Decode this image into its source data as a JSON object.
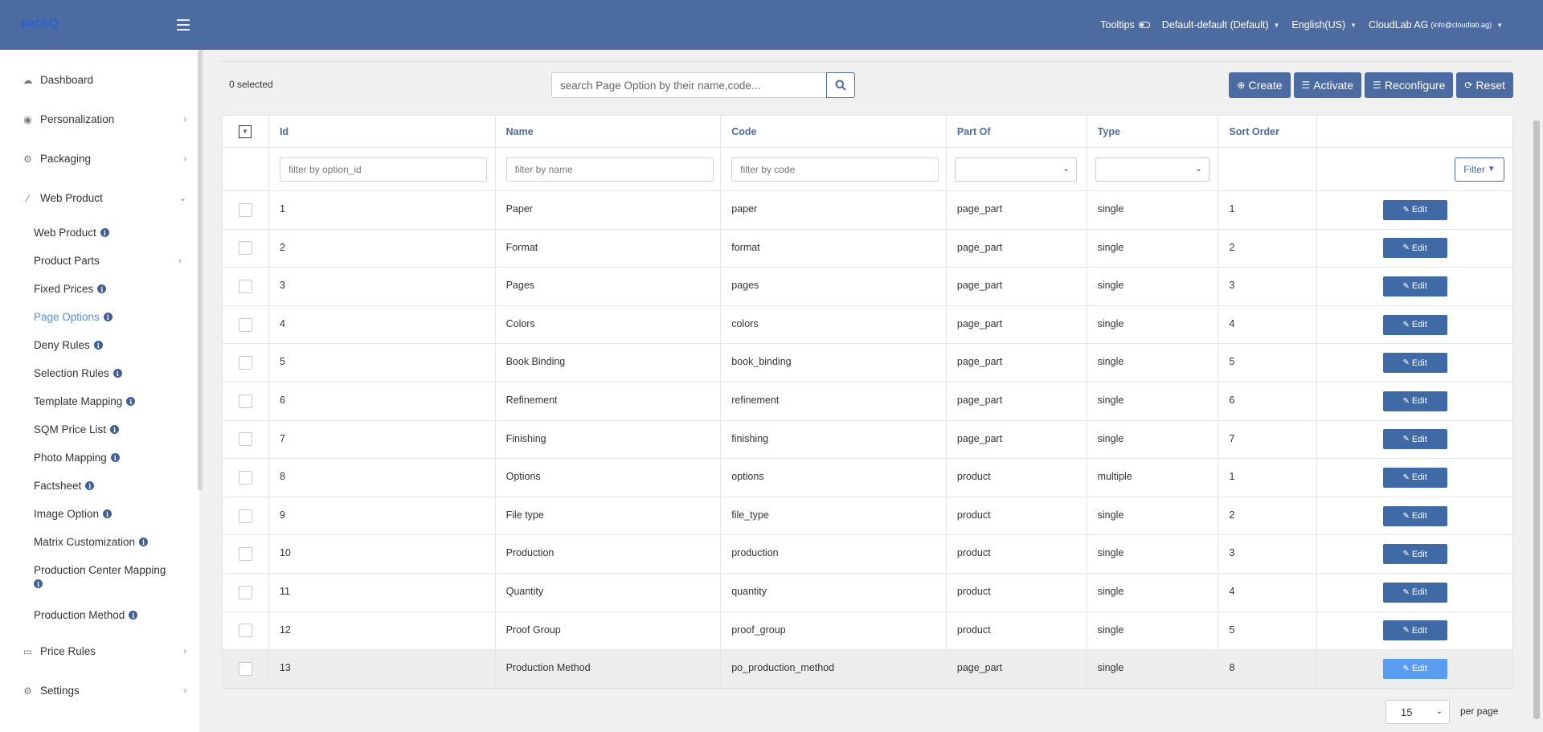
{
  "app": {
    "logo": "packQ"
  },
  "topnav": {
    "tooltips": "Tooltips",
    "branding": "Default-default (Default)",
    "language": "English(US)",
    "company": "CloudLab AG",
    "email": "(info@cloudlab.ag)"
  },
  "sidebar": {
    "dashboard": "Dashboard",
    "personalization": "Personalization",
    "packaging": "Packaging",
    "web_product": "Web Product",
    "sub": [
      "Web Product",
      "Product Parts",
      "Fixed Prices",
      "Page Options",
      "Deny Rules",
      "Selection Rules",
      "Template Mapping",
      "SQM Price List",
      "Photo Mapping",
      "Factsheet",
      "Image Option",
      "Matrix Customization",
      "Production Center Mapping",
      "Production Method"
    ],
    "price_rules": "Price Rules",
    "settings": "Settings"
  },
  "toolbar": {
    "selected": "0 selected",
    "search_placeholder": "search Page Option by their name,code...",
    "create": "Create",
    "activate": "Activate",
    "reconfigure": "Reconfigure",
    "reset": "Reset"
  },
  "table": {
    "headers": [
      "Id",
      "Name",
      "Code",
      "Part Of",
      "Type",
      "Sort Order"
    ],
    "filters": {
      "id_placeholder": "filter by option_id",
      "name_placeholder": "filter by name",
      "code_placeholder": "filter by code",
      "filter_button": "Filter"
    },
    "edit_label": "Edit",
    "rows": [
      {
        "id": "1",
        "name": "Paper",
        "code": "paper",
        "part_of": "page_part",
        "type": "single",
        "sort": "1"
      },
      {
        "id": "2",
        "name": "Format",
        "code": "format",
        "part_of": "page_part",
        "type": "single",
        "sort": "2"
      },
      {
        "id": "3",
        "name": "Pages",
        "code": "pages",
        "part_of": "page_part",
        "type": "single",
        "sort": "3"
      },
      {
        "id": "4",
        "name": "Colors",
        "code": "colors",
        "part_of": "page_part",
        "type": "single",
        "sort": "4"
      },
      {
        "id": "5",
        "name": "Book Binding",
        "code": "book_binding",
        "part_of": "page_part",
        "type": "single",
        "sort": "5"
      },
      {
        "id": "6",
        "name": "Refinement",
        "code": "refinement",
        "part_of": "page_part",
        "type": "single",
        "sort": "6"
      },
      {
        "id": "7",
        "name": "Finishing",
        "code": "finishing",
        "part_of": "page_part",
        "type": "single",
        "sort": "7"
      },
      {
        "id": "8",
        "name": "Options",
        "code": "options",
        "part_of": "product",
        "type": "multiple",
        "sort": "1"
      },
      {
        "id": "9",
        "name": "File type",
        "code": "file_type",
        "part_of": "product",
        "type": "single",
        "sort": "2"
      },
      {
        "id": "10",
        "name": "Production",
        "code": "production",
        "part_of": "product",
        "type": "single",
        "sort": "3"
      },
      {
        "id": "11",
        "name": "Quantity",
        "code": "quantity",
        "part_of": "product",
        "type": "single",
        "sort": "4"
      },
      {
        "id": "12",
        "name": "Proof Group",
        "code": "proof_group",
        "part_of": "product",
        "type": "single",
        "sort": "5"
      },
      {
        "id": "13",
        "name": "Production Method",
        "code": "po_production_method",
        "part_of": "page_part",
        "type": "single",
        "sort": "8"
      }
    ]
  },
  "pagination": {
    "per_page_value": "15",
    "per_page_label": "per page"
  },
  "colors": {
    "topbar": "#4c6ba1",
    "accent": "#4c6ba1",
    "active_link": "#5b8bd0",
    "edit_button": "#3f6aa6"
  }
}
